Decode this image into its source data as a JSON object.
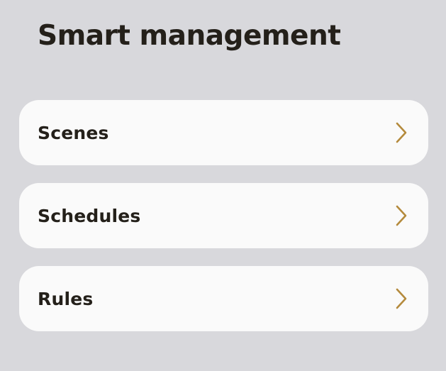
{
  "page": {
    "title": "Smart management"
  },
  "menu": {
    "items": [
      {
        "label": "Scenes",
        "icon": "chevron-right-icon"
      },
      {
        "label": "Schedules",
        "icon": "chevron-right-icon"
      },
      {
        "label": "Rules",
        "icon": "chevron-right-icon"
      }
    ]
  },
  "colors": {
    "background": "#d8d8dc",
    "card": "#fafafa",
    "text": "#24201a",
    "chevron": "#b48a3c"
  }
}
